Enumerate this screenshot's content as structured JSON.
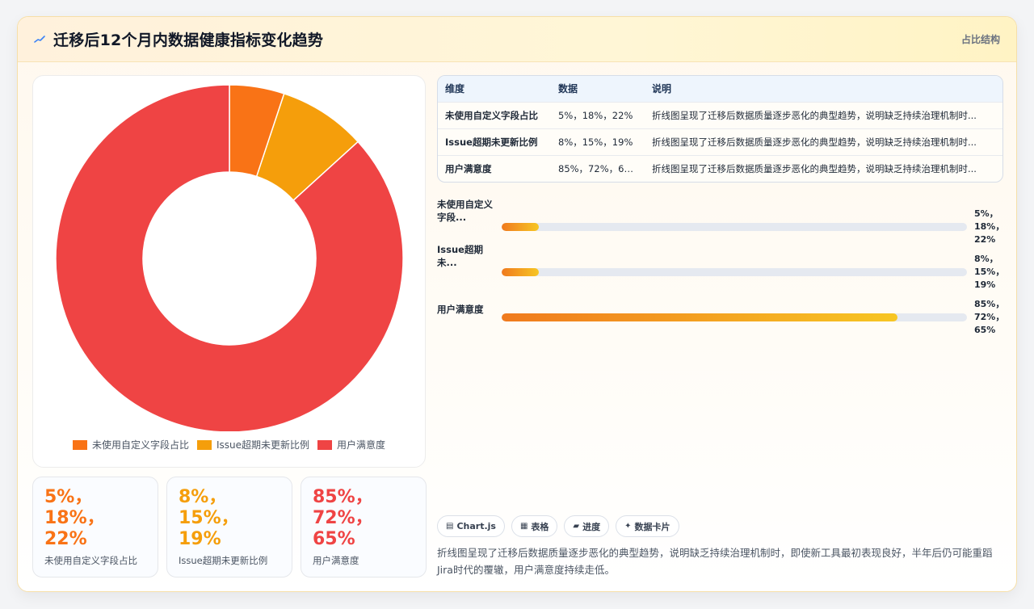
{
  "header": {
    "title": "迁移后12个月内数据健康指标变化趋势",
    "right_label": "占比结构"
  },
  "colors": {
    "orange": "#f97316",
    "amber": "#f59e0b",
    "red": "#ef4444"
  },
  "chart_data": {
    "type": "pie",
    "donut": true,
    "categories": [
      "未使用自定义字段占比",
      "Issue超期未更新比例",
      "用户满意度"
    ],
    "values": [
      5,
      8,
      85
    ],
    "colors": [
      "#f97316",
      "#f59e0b",
      "#ef4444"
    ],
    "legend_position": "bottom"
  },
  "stats": [
    {
      "value": "5%，\n18%，\n22%",
      "label": "未使用自定义字段占比",
      "color": "#f97316"
    },
    {
      "value": "8%，\n15%，\n19%",
      "label": "Issue超期未更新比例",
      "color": "#f59e0b"
    },
    {
      "value": "85%，\n72%，\n65%",
      "label": "用户满意度",
      "color": "#ef4444"
    }
  ],
  "table": {
    "headers": [
      "维度",
      "数据",
      "说明"
    ],
    "rows": [
      [
        "未使用自定义字段占比",
        "5%，18%，22%",
        "折线图呈现了迁移后数据质量逐步恶化的典型趋势，说明缺乏持续治理机制时..."
      ],
      [
        "Issue超期未更新比例",
        "8%，15%，19%",
        "折线图呈现了迁移后数据质量逐步恶化的典型趋势，说明缺乏持续治理机制时..."
      ],
      [
        "用户满意度",
        "85%，72%，65%",
        "折线图呈现了迁移后数据质量逐步恶化的典型趋势，说明缺乏持续治理机制时..."
      ]
    ]
  },
  "progress": [
    {
      "label": "未使用自定义字段...",
      "value_text": "5%，\n18%，\n22%",
      "fraction": 0.08
    },
    {
      "label": "Issue超期未...",
      "value_text": "8%，\n15%，\n19%",
      "fraction": 0.08
    },
    {
      "label": "用户满意度",
      "value_text": "85%，\n72%，\n65%",
      "fraction": 0.85
    }
  ],
  "chips": [
    {
      "icon": "▤",
      "label": "Chart.js"
    },
    {
      "icon": "▦",
      "label": "表格"
    },
    {
      "icon": "▰",
      "label": "进度"
    },
    {
      "icon": "✦",
      "label": "数据卡片"
    }
  ],
  "note": "折线图呈现了迁移后数据质量逐步恶化的典型趋势，说明缺乏持续治理机制时，即使新工具最初表现良好，半年后仍可能重蹈Jira时代的覆辙，用户满意度持续走低。"
}
